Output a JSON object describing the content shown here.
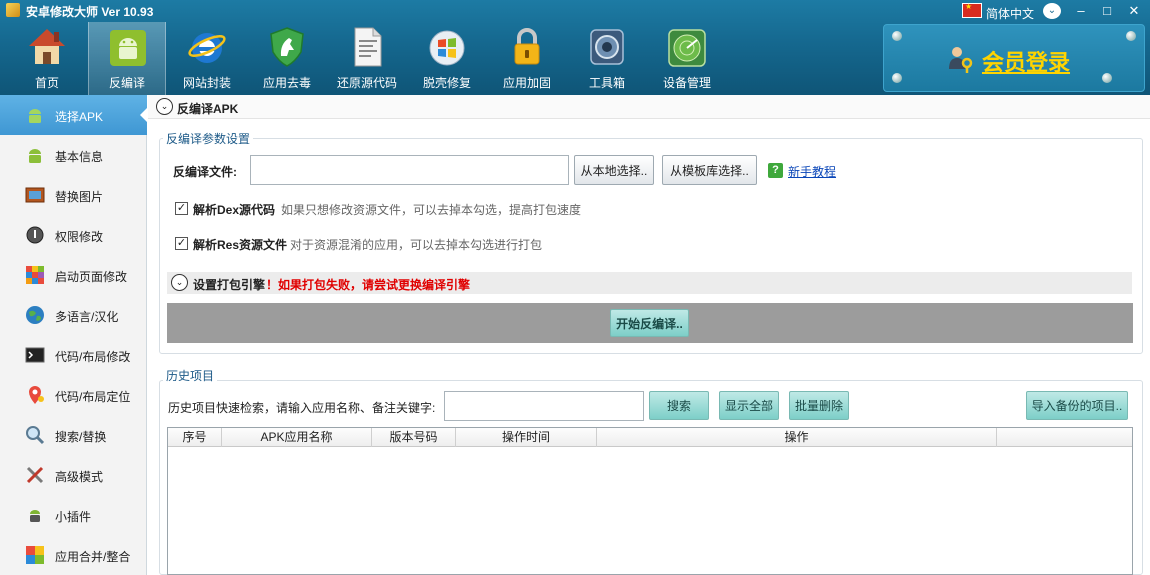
{
  "app": {
    "title": "安卓修改大师 Ver 10.93"
  },
  "titlebar": {
    "language": "简体中文",
    "minimize": "–",
    "maximize": "□",
    "close": "✕",
    "lang_dropdown": "⌄"
  },
  "toolbar": [
    {
      "label": "首页",
      "icon": "home-icon"
    },
    {
      "label": "反编译",
      "icon": "android-icon",
      "active": true
    },
    {
      "label": "网站封装",
      "icon": "browser-e-icon"
    },
    {
      "label": "应用去毒",
      "icon": "shield-horse-icon"
    },
    {
      "label": "还原源代码",
      "icon": "document-icon"
    },
    {
      "label": "脱壳修复",
      "icon": "windows-orb-icon"
    },
    {
      "label": "应用加固",
      "icon": "lock-icon"
    },
    {
      "label": "工具箱",
      "icon": "toolbox-icon"
    },
    {
      "label": "设备管理",
      "icon": "radar-icon"
    }
  ],
  "member": {
    "label": "会员登录"
  },
  "sidebar": [
    {
      "label": "选择APK",
      "icon": "android-icon",
      "active": true
    },
    {
      "label": "基本信息",
      "icon": "android-info-icon"
    },
    {
      "label": "替换图片",
      "icon": "picture-icon"
    },
    {
      "label": "权限修改",
      "icon": "permission-icon"
    },
    {
      "label": "启动页面修改",
      "icon": "launch-page-icon"
    },
    {
      "label": "多语言/汉化",
      "icon": "globe-icon"
    },
    {
      "label": "代码/布局修改",
      "icon": "terminal-icon"
    },
    {
      "label": "代码/布局定位",
      "icon": "map-pin-icon"
    },
    {
      "label": "搜索/替换",
      "icon": "magnifier-icon"
    },
    {
      "label": "高级模式",
      "icon": "tools-icon"
    },
    {
      "label": "小插件",
      "icon": "plugin-icon"
    },
    {
      "label": "应用合并/整合",
      "icon": "merge-icon"
    }
  ],
  "main": {
    "section_title": "反编译APK",
    "params": {
      "title": "反编译参数设置",
      "file_label": "反编译文件:",
      "file_value": "",
      "local_btn": "从本地选择..",
      "template_btn": "从模板库选择..",
      "tutorial_link": "新手教程",
      "dex_label": "解析Dex源代码",
      "dex_hint": "如果只想修改资源文件，可以去掉本勾选，提高打包速度",
      "dex_checked": true,
      "res_label": "解析Res资源文件",
      "res_hint": "对于资源混淆的应用，可以去掉本勾选进行打包",
      "res_checked": true,
      "engine_label": "设置打包引擎",
      "engine_warn": "！如果打包失败，请尝试更换编译引擎",
      "start_btn": "开始反编译.."
    },
    "history": {
      "title": "历史项目",
      "search_label": "历史项目快速检索，请输入应用名称、备注关键字:",
      "search_value": "",
      "search_btn": "搜索",
      "show_all_btn": "显示全部",
      "batch_delete_btn": "批量删除",
      "import_btn": "导入备份的项目..",
      "columns": [
        "序号",
        "APK应用名称",
        "版本号码",
        "操作时间",
        "操作"
      ]
    }
  }
}
